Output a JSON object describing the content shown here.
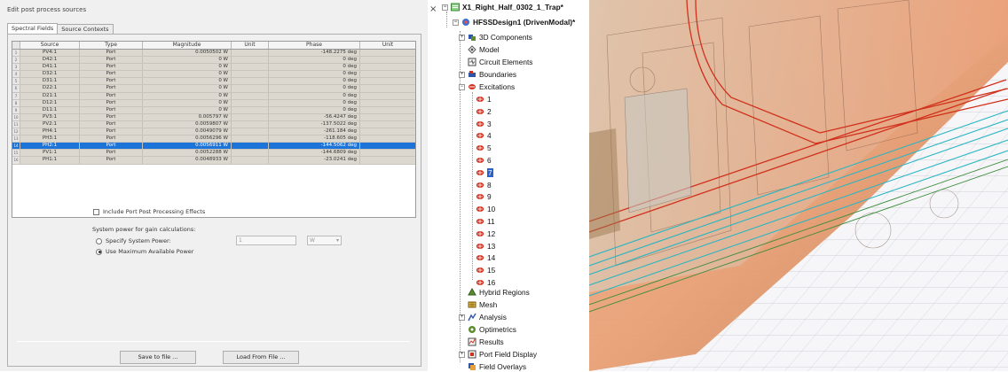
{
  "dialog": {
    "title": "Edit post process sources",
    "tabs": [
      "Spectral Fields",
      "Source Contexts"
    ],
    "columns": [
      "Source",
      "Type",
      "Magnitude",
      "Unit",
      "Phase",
      "Unit"
    ],
    "rows": [
      {
        "n": "1",
        "source": "PV4:1",
        "type": "Port",
        "magnitude": "0.0050502 W",
        "phase": "-148.2275 deg"
      },
      {
        "n": "2",
        "source": "D42:1",
        "type": "Port",
        "magnitude": "0 W",
        "phase": "0 deg"
      },
      {
        "n": "3",
        "source": "D41:1",
        "type": "Port",
        "magnitude": "0 W",
        "phase": "0 deg"
      },
      {
        "n": "4",
        "source": "D32:1",
        "type": "Port",
        "magnitude": "0 W",
        "phase": "0 deg"
      },
      {
        "n": "5",
        "source": "D31:1",
        "type": "Port",
        "magnitude": "0 W",
        "phase": "0 deg"
      },
      {
        "n": "6",
        "source": "D22:1",
        "type": "Port",
        "magnitude": "0 W",
        "phase": "0 deg"
      },
      {
        "n": "7",
        "source": "D21:1",
        "type": "Port",
        "magnitude": "0 W",
        "phase": "0 deg"
      },
      {
        "n": "8",
        "source": "D12:1",
        "type": "Port",
        "magnitude": "0 W",
        "phase": "0 deg"
      },
      {
        "n": "9",
        "source": "D11:1",
        "type": "Port",
        "magnitude": "0 W",
        "phase": "0 deg"
      },
      {
        "n": "10",
        "source": "PV3:1",
        "type": "Port",
        "magnitude": "0.005797 W",
        "phase": "-56.4247 deg"
      },
      {
        "n": "11",
        "source": "PV2:1",
        "type": "Port",
        "magnitude": "0.0059807 W",
        "phase": "-137.5022 deg"
      },
      {
        "n": "12",
        "source": "PH4:1",
        "type": "Port",
        "magnitude": "0.0049079 W",
        "phase": "-261.184 deg"
      },
      {
        "n": "13",
        "source": "PH3:1",
        "type": "Port",
        "magnitude": "0.0056296 W",
        "phase": "-118.605 deg"
      },
      {
        "n": "14",
        "source": "PH2:1",
        "type": "Port",
        "magnitude": "0.0056911 W",
        "phase": "-144.5062 deg",
        "selected": true
      },
      {
        "n": "15",
        "source": "PV1:1",
        "type": "Port",
        "magnitude": "0.0052288 W",
        "phase": "-144.6809 deg"
      },
      {
        "n": "16",
        "source": "PH1:1",
        "type": "Port",
        "magnitude": "0.0048933 W",
        "phase": "-23.0241 deg"
      }
    ],
    "include_port_label": "Include Port Post Processing Effects",
    "system_power_label": "System power for gain calculations:",
    "specify_power_label": "Specify System Power:",
    "max_power_label": "Use Maximum Available Power",
    "power_value": "1",
    "power_unit": "W",
    "save_button": "Save to file ...",
    "load_button": "Load From File ..."
  },
  "tree": {
    "close_glyph": "×",
    "project": "X1_Right_Half_0302_1_Trap*",
    "design": "HFSSDesign1 (DrivenModal)*",
    "items_top": [
      "3D Components",
      "Model",
      "Circuit Elements",
      "Boundaries",
      "Excitations"
    ],
    "excitations": [
      "1",
      "2",
      "3",
      "4",
      "5",
      "6",
      "7",
      "8",
      "9",
      "10",
      "11",
      "12",
      "13",
      "14",
      "15",
      "16"
    ],
    "selected_excitation": "7",
    "items_bottom": [
      "Hybrid Regions",
      "Mesh",
      "Analysis",
      "Optimetrics",
      "Results",
      "Port Field Display",
      "Field Overlays"
    ],
    "icons": {
      "project": "project-icon",
      "design": "hfss-design-icon",
      "excitation": "port-excitation-icon"
    }
  },
  "colors": {
    "selection": "#1c73d8",
    "grid_row": "#dcd8cf",
    "tree_select": "#2a62c9",
    "model_red": "#d0301c",
    "model_cyan": "#2bb5c2"
  }
}
